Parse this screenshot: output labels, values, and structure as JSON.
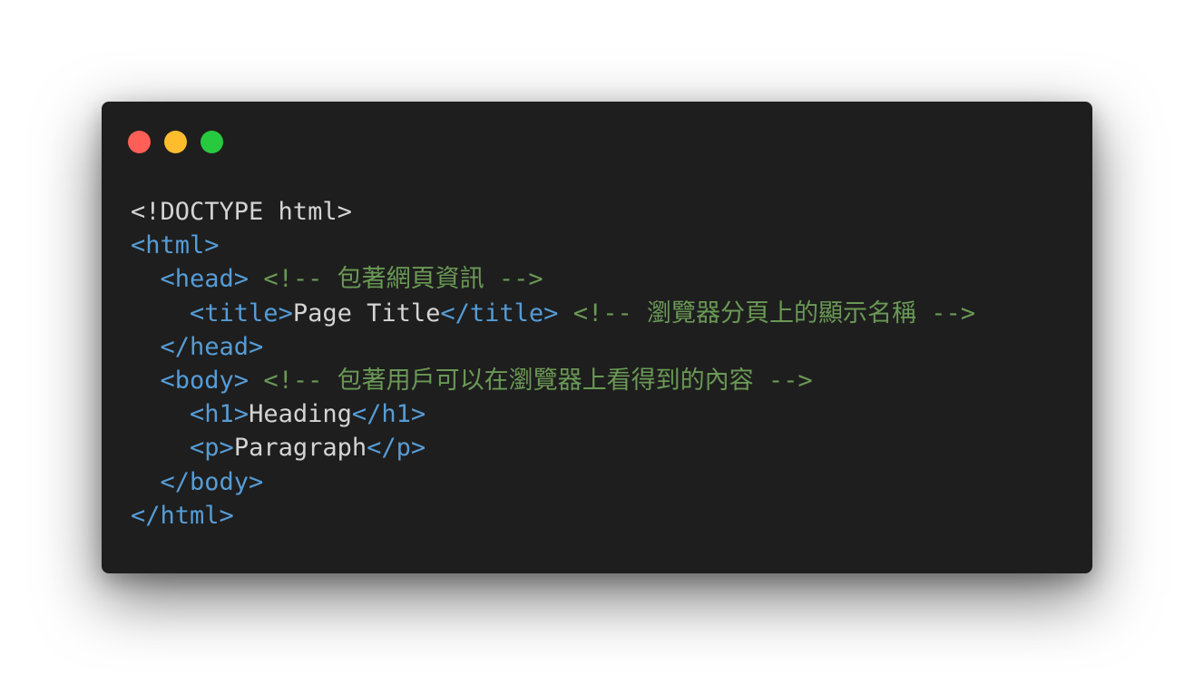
{
  "window": {
    "controls": [
      {
        "name": "close",
        "color": "#ff5f56"
      },
      {
        "name": "minimize",
        "color": "#ffbd2e"
      },
      {
        "name": "maximize",
        "color": "#27c93f"
      }
    ]
  },
  "colors": {
    "background": "#1e1e1e",
    "tag": "#569cd6",
    "text": "#d4d4d4",
    "comment": "#6a9955"
  },
  "code": {
    "lines": [
      {
        "indent": "",
        "segments": [
          {
            "type": "doctype",
            "text": "<!DOCTYPE html>"
          }
        ]
      },
      {
        "indent": "",
        "segments": [
          {
            "type": "tag",
            "text": "<html>"
          }
        ]
      },
      {
        "indent": "  ",
        "segments": [
          {
            "type": "tag",
            "text": "<head>"
          },
          {
            "type": "text",
            "text": " "
          },
          {
            "type": "comment",
            "text": "<!-- 包著網頁資訊 -->"
          }
        ]
      },
      {
        "indent": "    ",
        "segments": [
          {
            "type": "tag",
            "text": "<title>"
          },
          {
            "type": "text",
            "text": "Page Title"
          },
          {
            "type": "tag",
            "text": "</title>"
          },
          {
            "type": "text",
            "text": " "
          },
          {
            "type": "comment",
            "text": "<!-- 瀏覽器分頁上的顯示名稱 -->"
          }
        ]
      },
      {
        "indent": "  ",
        "segments": [
          {
            "type": "tag",
            "text": "</head>"
          }
        ]
      },
      {
        "indent": "  ",
        "segments": [
          {
            "type": "tag",
            "text": "<body>"
          },
          {
            "type": "text",
            "text": " "
          },
          {
            "type": "comment",
            "text": "<!-- 包著用戶可以在瀏覽器上看得到的內容 -->"
          }
        ]
      },
      {
        "indent": "    ",
        "segments": [
          {
            "type": "tag",
            "text": "<h1>"
          },
          {
            "type": "text",
            "text": "Heading"
          },
          {
            "type": "tag",
            "text": "</h1>"
          }
        ]
      },
      {
        "indent": "    ",
        "segments": [
          {
            "type": "tag",
            "text": "<p>"
          },
          {
            "type": "text",
            "text": "Paragraph"
          },
          {
            "type": "tag",
            "text": "</p>"
          }
        ]
      },
      {
        "indent": "  ",
        "segments": [
          {
            "type": "tag",
            "text": "</body>"
          }
        ]
      },
      {
        "indent": "",
        "segments": [
          {
            "type": "tag",
            "text": "</html>"
          }
        ]
      }
    ]
  }
}
